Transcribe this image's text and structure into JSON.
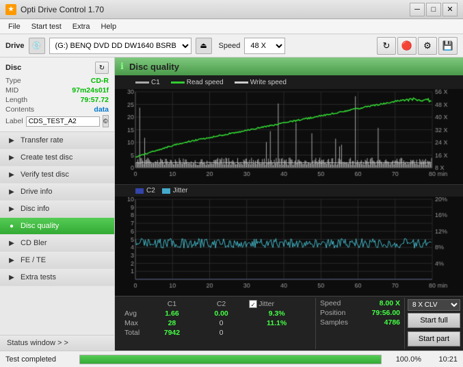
{
  "titleBar": {
    "title": "Opti Drive Control 1.70",
    "icon": "★"
  },
  "menuBar": {
    "items": [
      "File",
      "Start test",
      "Extra",
      "Help"
    ]
  },
  "driveBar": {
    "label": "Drive",
    "driveValue": "(G:)  BENQ DVD DD DW1640 BSRB",
    "speedLabel": "Speed",
    "speedValue": "48 X"
  },
  "disc": {
    "title": "Disc",
    "type_label": "Type",
    "type_value": "CD-R",
    "mid_label": "MID",
    "mid_value": "97m24s01f",
    "length_label": "Length",
    "length_value": "79:57.72",
    "contents_label": "Contents",
    "contents_value": "data",
    "label_label": "Label",
    "label_value": "CDS_TEST_A2"
  },
  "nav": {
    "items": [
      {
        "id": "transfer-rate",
        "label": "Transfer rate"
      },
      {
        "id": "create-test-disc",
        "label": "Create test disc"
      },
      {
        "id": "verify-test-disc",
        "label": "Verify test disc"
      },
      {
        "id": "drive-info",
        "label": "Drive info"
      },
      {
        "id": "disc-info",
        "label": "Disc info"
      },
      {
        "id": "disc-quality",
        "label": "Disc quality",
        "active": true
      },
      {
        "id": "cd-bler",
        "label": "CD Bler"
      },
      {
        "id": "fe-te",
        "label": "FE / TE"
      },
      {
        "id": "extra-tests",
        "label": "Extra tests"
      }
    ],
    "statusWindow": "Status window > >"
  },
  "chartHeader": {
    "title": "Disc quality"
  },
  "legend": {
    "c1": "C1",
    "readSpeed": "Read speed",
    "writeSpeed": "Write speed"
  },
  "topChart": {
    "yMax": 30,
    "yLabels": [
      "30",
      "25",
      "20",
      "15",
      "10",
      "5",
      ""
    ],
    "xLabels": [
      "0",
      "10",
      "20",
      "30",
      "40",
      "50",
      "60",
      "70",
      "80"
    ],
    "rightLabels": [
      "56 X",
      "48 X",
      "40 X",
      "32 X",
      "24 X",
      "16 X",
      "8 X"
    ],
    "xAxisLabel": "min"
  },
  "bottomChart": {
    "label": "C2",
    "jitterLabel": "Jitter",
    "yMax": 10,
    "yLabels": [
      "10",
      "9",
      "8",
      "7",
      "6",
      "5",
      "4",
      "3",
      "2",
      "1",
      ""
    ],
    "xLabels": [
      "0",
      "10",
      "20",
      "30",
      "40",
      "50",
      "60",
      "70",
      "80"
    ],
    "rightLabels": [
      "20%",
      "16%",
      "12%",
      "8%",
      "4%",
      ""
    ],
    "xAxisLabel": "min"
  },
  "stats": {
    "headers": [
      "",
      "C1",
      "C2",
      "Jitter",
      "Speed",
      "",
      "Position",
      "Samples"
    ],
    "avg_label": "Avg",
    "avg_c1": "1.66",
    "avg_c2": "0.00",
    "avg_jitter": "9.3%",
    "avg_speed": "8.00 X",
    "max_label": "Max",
    "max_c1": "28",
    "max_c2": "0",
    "max_jitter": "11.1%",
    "position_val": "79:56.00",
    "total_label": "Total",
    "total_c1": "7942",
    "total_c2": "0",
    "samples_val": "4786"
  },
  "rightPanel": {
    "clvOption": "8 X CLV",
    "startFull": "Start full",
    "startPart": "Start part"
  },
  "statusBar": {
    "text": "Test completed",
    "progress": 100,
    "progressText": "100.0%",
    "time": "10:21"
  }
}
